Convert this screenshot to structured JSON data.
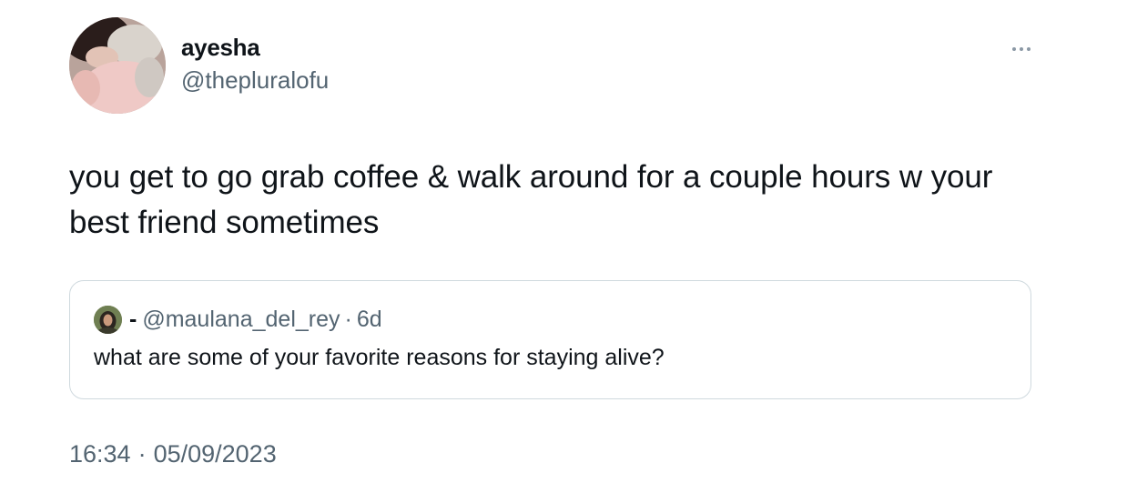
{
  "author": {
    "display_name": "ayesha",
    "handle": "@thepluralofu"
  },
  "tweet": {
    "text": "you get to go grab coffee & walk around for a couple hours w your best friend sometimes"
  },
  "quoted_tweet": {
    "display_name": "-",
    "handle": "@maulana_del_rey",
    "separator": "·",
    "relative_time": "6d",
    "text": "what are some of your favorite reasons for staying alive?"
  },
  "meta": {
    "time": "16:34",
    "separator": "·",
    "date": "05/09/2023"
  },
  "icons": {
    "more": "more-horizontal-icon"
  },
  "colors": {
    "primary_text": "#0f1419",
    "secondary_text": "#536471",
    "border": "#cfd9de"
  }
}
